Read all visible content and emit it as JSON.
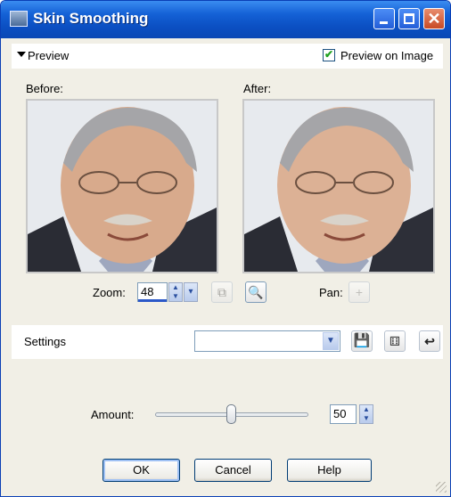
{
  "window": {
    "title": "Skin Smoothing",
    "controls": [
      "minimize-icon",
      "maximize-icon",
      "close-icon"
    ],
    "colors": {
      "titlebar": "#0b4fc2",
      "body": "#f1efe6"
    }
  },
  "preview": {
    "label": "Preview",
    "preview_on_image": {
      "label": "Preview on Image",
      "checked": true
    },
    "before_label": "Before:",
    "after_label": "After:"
  },
  "zoom": {
    "label": "Zoom:",
    "value": "48"
  },
  "pan": {
    "label": "Pan:"
  },
  "settings": {
    "label": "Settings",
    "selected": ""
  },
  "amount": {
    "label": "Amount:",
    "value": "50",
    "slider_fraction": 0.5
  },
  "buttons": {
    "ok": "OK",
    "cancel": "Cancel",
    "help": "Help"
  }
}
